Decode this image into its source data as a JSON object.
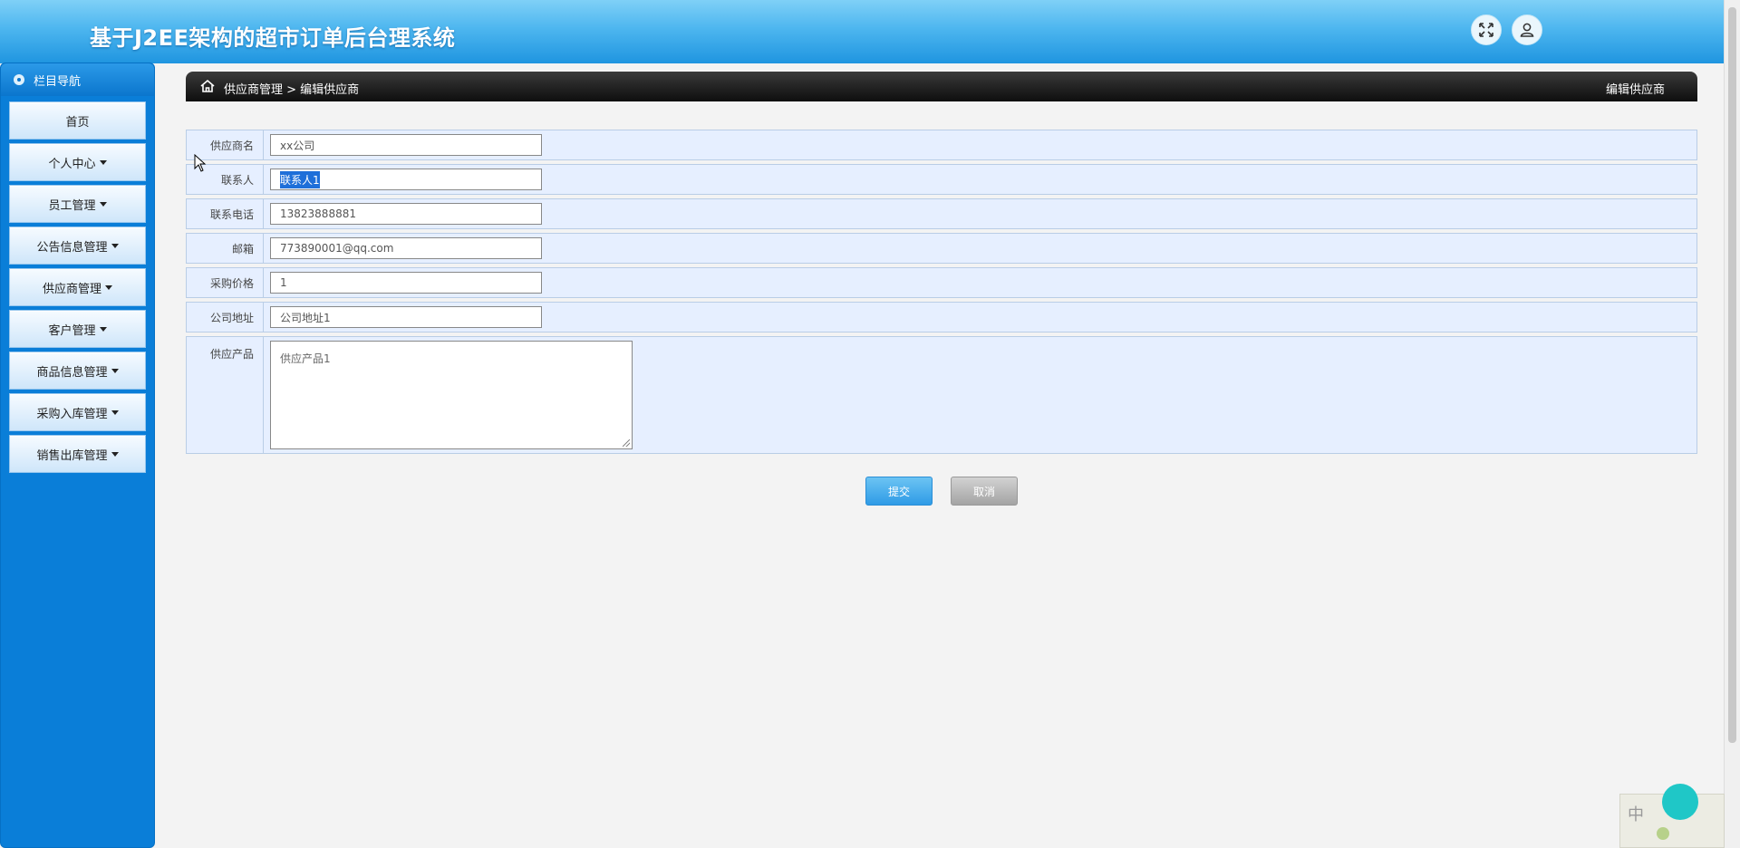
{
  "app": {
    "title": "基于J2EE架构的超市订单后台理系统"
  },
  "header": {
    "fullscreen_icon": "fullscreen-icon",
    "user_icon": "user-icon"
  },
  "sidebar": {
    "heading": "栏目导航",
    "items": [
      {
        "label": "首页",
        "dropdown": false
      },
      {
        "label": "个人中心",
        "dropdown": true
      },
      {
        "label": "员工管理",
        "dropdown": true
      },
      {
        "label": "公告信息管理",
        "dropdown": true
      },
      {
        "label": "供应商管理",
        "dropdown": true
      },
      {
        "label": "客户管理",
        "dropdown": true
      },
      {
        "label": "商品信息管理",
        "dropdown": true
      },
      {
        "label": "采购入库管理",
        "dropdown": true
      },
      {
        "label": "销售出库管理",
        "dropdown": true
      }
    ]
  },
  "breadcrumb": {
    "path": "供应商管理 > 编辑供应商",
    "right": "编辑供应商"
  },
  "form": {
    "fields": [
      {
        "label": "供应商名",
        "value": "xx公司"
      },
      {
        "label": "联系人",
        "value": "联系人1"
      },
      {
        "label": "联系电话",
        "value": "13823888881"
      },
      {
        "label": "邮箱",
        "value": "773890001@qq.com"
      },
      {
        "label": "采购价格",
        "value": "1"
      },
      {
        "label": "公司地址",
        "value": "公司地址1"
      }
    ],
    "textarea": {
      "label": "供应产品",
      "value": "供应产品1"
    },
    "submit_label": "提交",
    "cancel_label": "取消"
  },
  "ime": {
    "mode": "中"
  },
  "colors": {
    "header": "#4db6ef",
    "sidebar": "#0a7ed8",
    "submit": "#2f9be6",
    "cancel": "#a4a4a4"
  }
}
